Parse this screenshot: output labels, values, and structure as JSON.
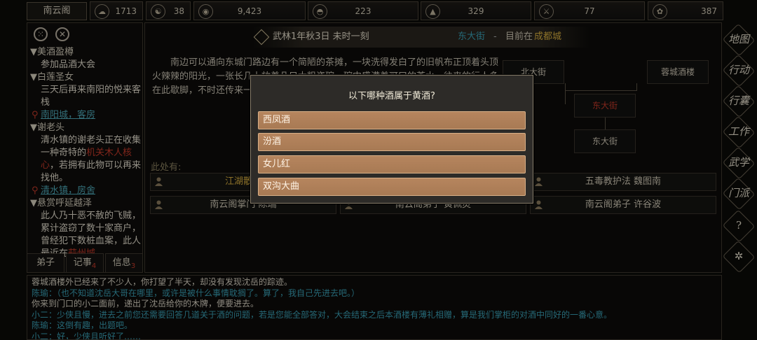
{
  "top_bar": {
    "sect_name": "南云阁",
    "stats": [
      {
        "icon": "ink-icon",
        "glyph": "☁",
        "value": "1713"
      },
      {
        "icon": "yin-yang-icon",
        "glyph": "☯",
        "value": "38"
      },
      {
        "icon": "coin-icon",
        "glyph": "◉",
        "value": "9,423"
      },
      {
        "icon": "food-bowl-icon",
        "glyph": "◓",
        "value": "223"
      },
      {
        "icon": "mountain-icon",
        "glyph": "▲",
        "value": "329"
      },
      {
        "icon": "sword-icon",
        "glyph": "⚔",
        "value": "77"
      },
      {
        "icon": "cloud-icon",
        "glyph": "✿",
        "value": "387"
      }
    ]
  },
  "left_panel": {
    "quests": [
      {
        "title": "美酒盈樽",
        "desc": "参加品酒大会"
      },
      {
        "title": "白莲圣女",
        "desc": "三天后再来南阳的悦来客栈",
        "location": "南阳城，客房"
      },
      {
        "title": "谢老头",
        "desc_pre": "清水镇的谢老头正在收集一种奇特的",
        "desc_red": "机关木人核心",
        "desc_post": "，若拥有此物可以再来找他。",
        "location": "清水镇，房舍"
      },
      {
        "title": "悬赏呼延越泽",
        "desc_pre": "此人乃十恶不赦的飞贼，累计盗窃了数十家商户，曾经犯下数桩血案，此人最近在",
        "desc_link": "蒜州城"
      }
    ],
    "tabs": [
      {
        "label": "弟子",
        "badge": ""
      },
      {
        "label": "记事",
        "badge": "4"
      },
      {
        "label": "信息",
        "badge": "3"
      }
    ]
  },
  "center": {
    "date": "武林1年秋3日 未时一刻",
    "location_name": "东大街",
    "location_sep": "-",
    "location_prefix": "目前在",
    "city": "成都城",
    "description": "南边可以通向东城门路边有一个简陋的茶摊，一块洗得发白了的旧帆布正顶着头顶火辣辣的阳光，一张长几上放着几只大粗瓷碗，碗中盛满着可口的茶水。往来的行人多在此歇脚，不时还传来一阵阵划拳的喧闹。",
    "map": {
      "north": "北大街",
      "northeast": "蓉城酒楼",
      "current": "东大街",
      "south": "东大街"
    },
    "here_label": "此处有:",
    "npcs": [
      {
        "name": "江湖散人"
      },
      {
        "name": "五毒教护法 魏图南"
      },
      {
        "name": "南云阁掌门 陈瑞"
      },
      {
        "name": "南云阁弟子 黄佩灵"
      },
      {
        "name": "南云阁弟子 许谷波"
      }
    ]
  },
  "right_menu": [
    {
      "label": "地图",
      "icon": "map-icon"
    },
    {
      "label": "行动",
      "icon": "action-icon"
    },
    {
      "label": "行囊",
      "icon": "bag-icon"
    },
    {
      "label": "工作",
      "icon": "work-icon"
    },
    {
      "label": "武学",
      "icon": "martial-icon"
    },
    {
      "label": "门派",
      "icon": "sect-icon"
    },
    {
      "label": "?",
      "icon": "help-icon"
    },
    {
      "label": "✲",
      "icon": "settings-icon"
    }
  ],
  "log": [
    {
      "text": "蓉城酒楼外已经来了不少人，你打望了半天，却没有发现沈岳的踪迹。",
      "color": "white"
    },
    {
      "text": "陈瑜：（也不知道沈岳大哥在哪里，或许是被什么事情耽搁了。算了，我自己先进去吧。）",
      "color": "cyan"
    },
    {
      "text": "你来到门口的小二面前，递出了沈岳给你的木牌，便要进去。",
      "color": "white"
    },
    {
      "text": "小二：少侠且慢，进去之前您还需要回答几道关于酒的问题，若是您能全部答对，大会结束之后本酒楼有薄礼相赠，算是我们掌柜的对酒中同好的一番心意。",
      "color": "cyan"
    },
    {
      "text": "陈瑜：这倒有趣，出题吧。",
      "color": "cyan"
    },
    {
      "text": "小二：好，少侠且听好了……",
      "color": "cyan"
    }
  ],
  "dialog": {
    "question": "以下哪种酒属于黄酒?",
    "options": [
      "西凤酒",
      "汾酒",
      "女儿红",
      "双沟大曲"
    ]
  }
}
